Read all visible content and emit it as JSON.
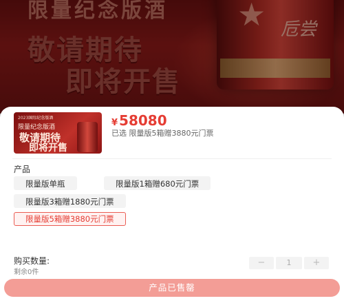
{
  "banner": {
    "top_text": "限量纪念版酒",
    "headline_1": "敬请期待",
    "headline_2": "即将开售",
    "bottle_logo": "卮尝"
  },
  "product": {
    "thumb_badge": "2023国际纪念版酒",
    "thumb_subtitle": "限量纪念版酒",
    "thumb_line_1": "敬请期待",
    "thumb_line_2": "即将开售",
    "currency": "¥",
    "price": "58080",
    "selected_text": "已选 限量版5箱赠3880元门票"
  },
  "options": {
    "label": "产品",
    "items": [
      {
        "label": "限量版单瓶",
        "active": false
      },
      {
        "label": "限量版1箱赠680元门票",
        "active": false
      },
      {
        "label": "限量版3箱赠1880元门票",
        "active": false
      },
      {
        "label": "限量版5箱赠3880元门票",
        "active": true
      }
    ]
  },
  "quantity": {
    "label": "购买数量:",
    "stock": "剩余0件",
    "minus": "−",
    "value": "1",
    "plus": "+"
  },
  "cta": {
    "label": "产品已售罄"
  },
  "colors": {
    "accent": "#e53d34",
    "sold_out_button": "#f39d96",
    "banner": "#8c1a18"
  }
}
